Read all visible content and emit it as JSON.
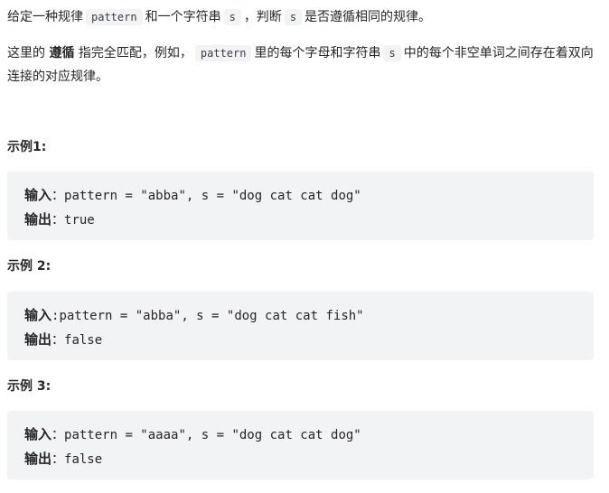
{
  "intro": {
    "p1_a": "给定一种规律",
    "p1_code1": "pattern",
    "p1_b": "和一个字符串",
    "p1_code2": "s",
    "p1_c": "，判断",
    "p1_code3": "s",
    "p1_d": "是否遵循相同的规律。",
    "p2_a": "这里的",
    "p2_strong": "遵循",
    "p2_b": "指完全匹配，例如，",
    "p2_code1": "pattern",
    "p2_c": "里的每个字母和字符串",
    "p2_code2": "s",
    "p2_d": "中的每个非空单词之间存在着双向连接的对应规律。"
  },
  "examples": [
    {
      "title": "示例1:",
      "input_label": "输入",
      "input_colon": "：",
      "input_value": "pattern = \"abba\", s = \"dog cat cat dog\"",
      "output_label": "输出",
      "output_colon": "：",
      "output_value": "true"
    },
    {
      "title": "示例 2:",
      "input_label": "输入",
      "input_colon": ":",
      "input_value": "pattern = \"abba\", s = \"dog cat cat fish\"",
      "output_label": "输出",
      "output_colon": "：",
      "output_value": "false"
    },
    {
      "title": "示例 3:",
      "input_label": "输入",
      "input_colon": "：",
      "input_value": "pattern = \"aaaa\", s = \"dog cat cat dog\"",
      "output_label": "输出",
      "output_colon": "：",
      "output_value": "false"
    }
  ]
}
